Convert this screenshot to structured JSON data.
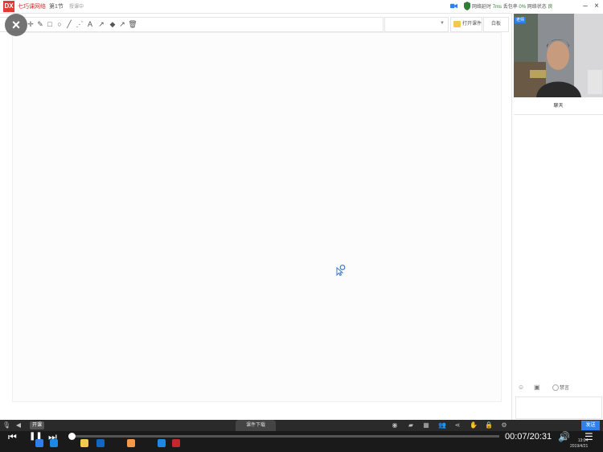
{
  "titlebar": {
    "logo": "DX",
    "app_name": "七巧课网络",
    "section": "第1节",
    "status": "授课中",
    "network": {
      "latency_label": "网络延时",
      "latency_value": "7ms",
      "loss_label": "丢包率",
      "loss_value": "0%",
      "state_label": "网络状态",
      "state_value": "良"
    },
    "minimize": "–",
    "close": "×"
  },
  "toolbar": {
    "tools": [
      "move-icon",
      "pen-icon",
      "rectangle-icon",
      "ellipse-icon",
      "line-icon",
      "dashed-line-icon",
      "text-icon",
      "arrow-icon",
      "eraser-icon",
      "laser-icon",
      "delete-icon"
    ],
    "text_tool": "A",
    "font_select": "",
    "open_file_label": "打开课件",
    "whiteboard_label": "白板"
  },
  "overlay": {
    "close_label": "×"
  },
  "right_panel": {
    "video_badge": "老师",
    "chat_tab": "聊天",
    "mute_label": "禁言",
    "send_label": "发送"
  },
  "player": {
    "progress_fraction": 0.0057,
    "time": "00:07/20:31",
    "prev_label": "⏮",
    "play_label": "❚❚",
    "next_label": "⏭",
    "volume_label": "🔊",
    "menu_label": "☰",
    "mini_label": "开课",
    "center_tab": "课件下载",
    "clock_time": "13:04",
    "clock_date": "2019/4/21"
  },
  "colors": {
    "accent": "#2f80ed",
    "brand": "#e53935",
    "net_good": "#2e7d32"
  }
}
